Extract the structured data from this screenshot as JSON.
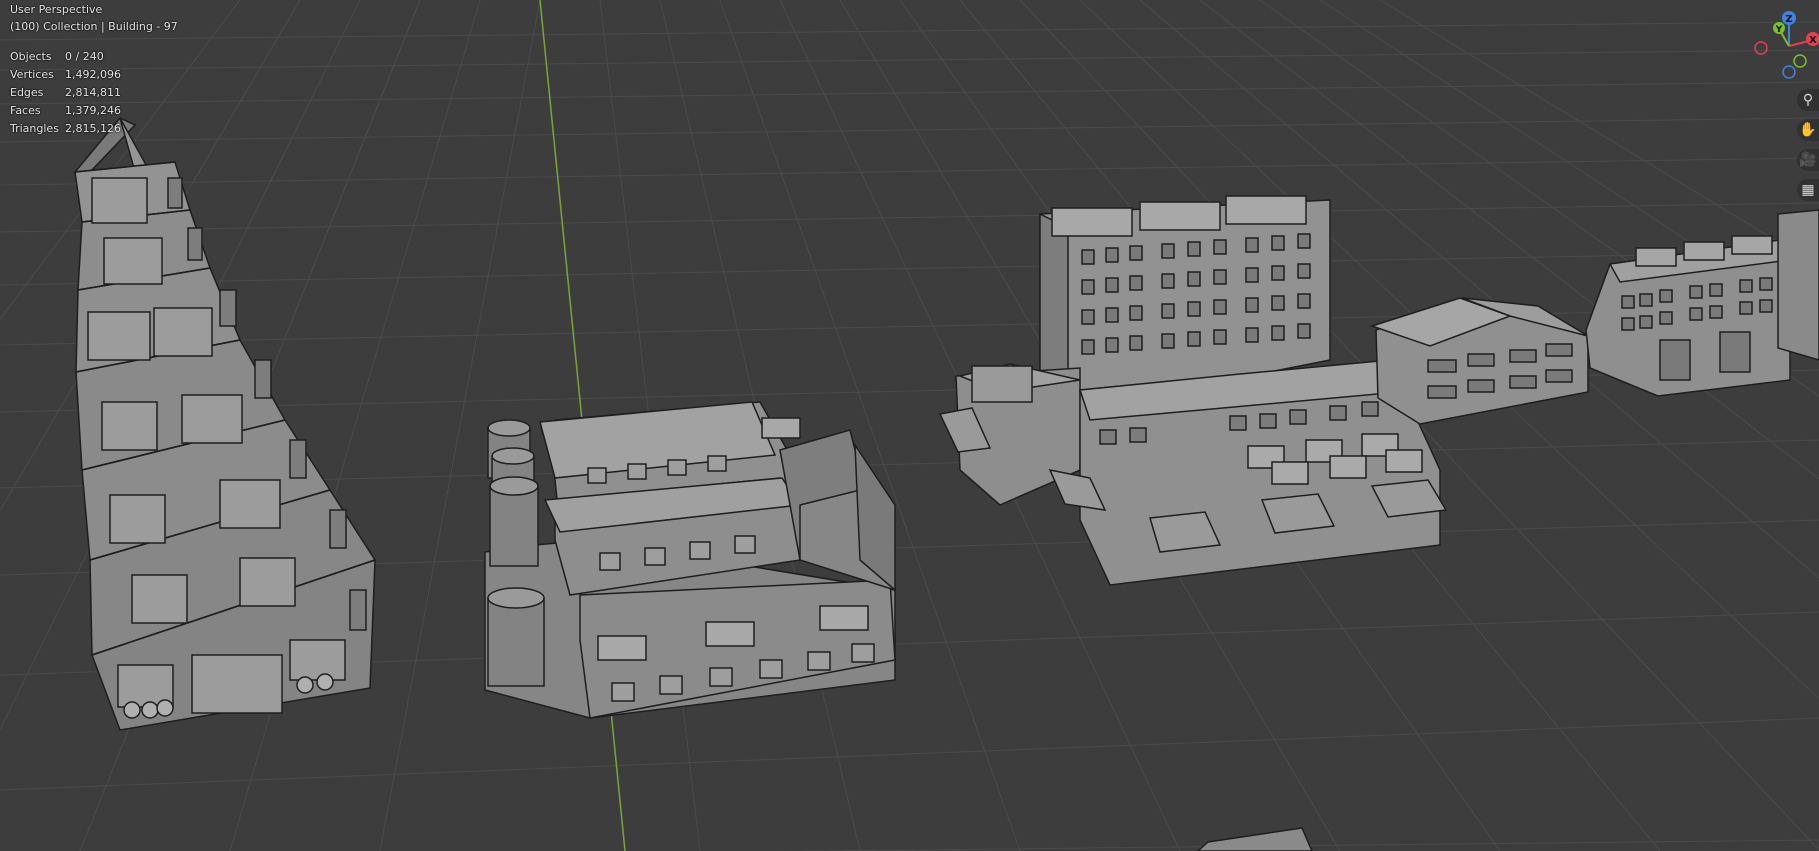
{
  "viewport": {
    "view_name": "User Perspective",
    "collection_info": "(100) Collection | Building - 97"
  },
  "stats": [
    {
      "label": "Objects",
      "value": "0 / 240"
    },
    {
      "label": "Vertices",
      "value": "1,492,096"
    },
    {
      "label": "Edges",
      "value": "2,814,811"
    },
    {
      "label": "Faces",
      "value": "1,379,246"
    },
    {
      "label": "Triangles",
      "value": "2,815,126"
    }
  ],
  "gizmo": {
    "z_label": "Z",
    "x_label": "X",
    "y_label": "Y",
    "colors": {
      "x": "#e2404f",
      "y": "#7bbf2a",
      "z": "#3d84e0"
    }
  },
  "nav_buttons": [
    {
      "name": "zoom-icon",
      "glyph": "⚲"
    },
    {
      "name": "pan-hand-icon",
      "glyph": "✋"
    },
    {
      "name": "camera-icon",
      "glyph": "🎥"
    },
    {
      "name": "grid-perspective-icon",
      "glyph": "▦"
    }
  ],
  "colors": {
    "background": "#3d3d3d",
    "grid_line": "#4a4a4a",
    "y_axis": "#7aa53a",
    "building_face": "#8e8e8e",
    "building_edge": "#1e1e1e"
  }
}
